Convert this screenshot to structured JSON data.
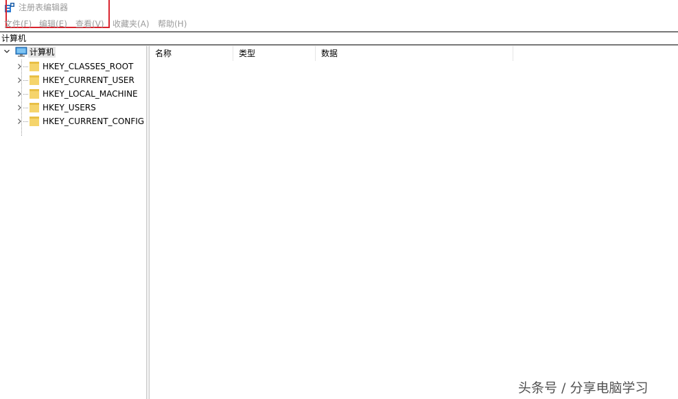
{
  "window": {
    "title": "注册表编辑器",
    "icon": "registry-editor-icon"
  },
  "menu": [
    {
      "label": "文件(F)"
    },
    {
      "label": "编辑(E)"
    },
    {
      "label": "查看(V)"
    },
    {
      "label": "收藏夹(A)"
    },
    {
      "label": "帮助(H)"
    }
  ],
  "address": {
    "path": "计算机"
  },
  "tree": {
    "root": {
      "label": "计算机",
      "icon": "computer-icon",
      "expanded": true,
      "selected": true
    },
    "items": [
      {
        "label": "HKEY_CLASSES_ROOT",
        "icon": "folder-icon"
      },
      {
        "label": "HKEY_CURRENT_USER",
        "icon": "folder-icon"
      },
      {
        "label": "HKEY_LOCAL_MACHINE",
        "icon": "folder-icon"
      },
      {
        "label": "HKEY_USERS",
        "icon": "folder-icon"
      },
      {
        "label": "HKEY_CURRENT_CONFIG",
        "icon": "folder-icon"
      }
    ]
  },
  "list": {
    "columns": [
      {
        "label": "名称"
      },
      {
        "label": "类型"
      },
      {
        "label": "数据"
      }
    ]
  },
  "watermark": {
    "text": "头条号 / 分享电脑学习"
  },
  "colors": {
    "highlight": "#d9232d",
    "folder": "#f5d46b",
    "selection": "#e5e5e5",
    "menu_text": "#9a9a9a"
  }
}
